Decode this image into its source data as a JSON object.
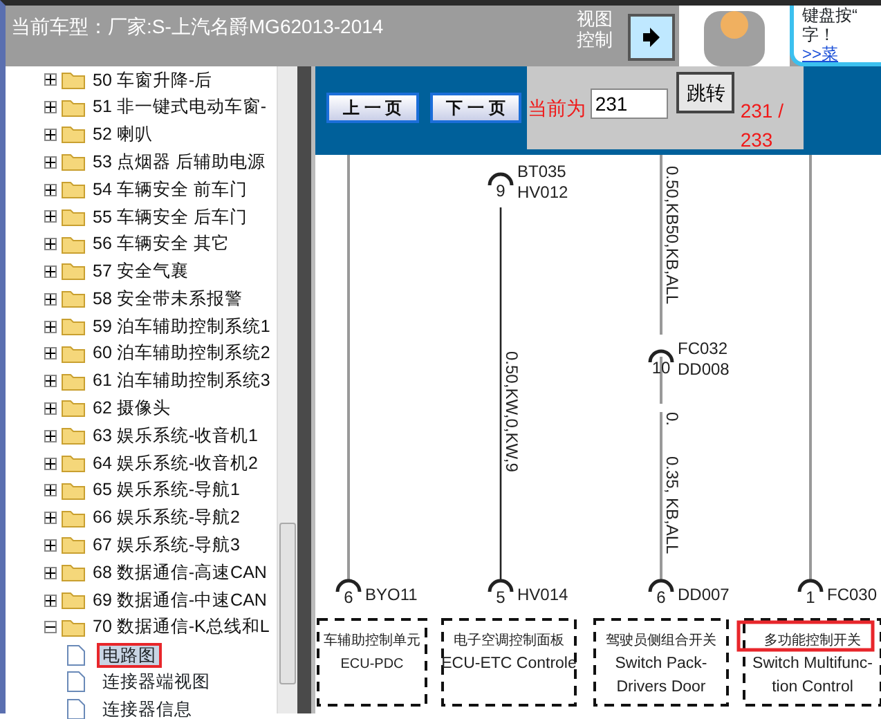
{
  "header": {
    "title": "当前车型：厂家:S-上汽名爵MG62013-2014",
    "view_label": [
      "视图",
      "控制"
    ]
  },
  "ad": {
    "lines": [
      "键盘按“",
      "字！",
      ">>菜"
    ]
  },
  "tree": {
    "items": [
      {
        "label": "50  车窗升降-后",
        "expanded": false
      },
      {
        "label": "51  非一键式电动车窗-",
        "expanded": false
      },
      {
        "label": "52  喇叭",
        "expanded": false
      },
      {
        "label": "53  点烟器 后辅助电源",
        "expanded": false
      },
      {
        "label": "54  车辆安全 前车门",
        "expanded": false
      },
      {
        "label": "55  车辆安全 后车门",
        "expanded": false
      },
      {
        "label": "56  车辆安全 其它",
        "expanded": false
      },
      {
        "label": "57  安全气襄",
        "expanded": false
      },
      {
        "label": "58  安全带未系报警",
        "expanded": false
      },
      {
        "label": "59  泊车辅助控制系统1",
        "expanded": false
      },
      {
        "label": "60  泊车辅助控制系统2",
        "expanded": false
      },
      {
        "label": "61  泊车辅助控制系统3",
        "expanded": false
      },
      {
        "label": "62  摄像头",
        "expanded": false
      },
      {
        "label": "63  娱乐系统-收音机1",
        "expanded": false
      },
      {
        "label": "64  娱乐系统-收音机2",
        "expanded": false
      },
      {
        "label": "65  娱乐系统-导航1",
        "expanded": false
      },
      {
        "label": "66  娱乐系统-导航2",
        "expanded": false
      },
      {
        "label": "67  娱乐系统-导航3",
        "expanded": false
      },
      {
        "label": "68  数据通信-高速CAN",
        "expanded": false
      },
      {
        "label": "69  数据通信-中速CAN",
        "expanded": false
      },
      {
        "label": "70  数据通信-K总线和L",
        "expanded": true,
        "children": [
          {
            "label": "电路图",
            "selected": true,
            "highlighted": true
          },
          {
            "label": "连接器端视图",
            "selected": false,
            "highlighted": false
          },
          {
            "label": "连接器信息",
            "selected": false,
            "highlighted": false
          }
        ]
      }
    ]
  },
  "pager": {
    "prev": "上 一 页",
    "next": "下 一 页",
    "current_label": "当前为",
    "page_value": "231",
    "jump": "跳转",
    "total": "231 / 233"
  },
  "diagram": {
    "top_connectors": [
      {
        "pin": "9",
        "codes": [
          "BT035",
          "HV012"
        ]
      },
      {
        "pin": "10",
        "codes": [
          "FC032",
          "DD008"
        ]
      }
    ],
    "wire_labels": [
      "0.50,KB50,KB,ALL",
      "0.50,KW,0,KW,9",
      "0.",
      "0.35, KB,ALL"
    ],
    "components": [
      {
        "pin": "6",
        "code": "BYO11",
        "lines": [
          "车辅助控制单元",
          "ECU-PDC"
        ],
        "highlighted": false
      },
      {
        "pin": "5",
        "code": "HV014",
        "lines": [
          "电子空调控制面板",
          "ECU-ETC Controle"
        ],
        "highlighted": false
      },
      {
        "pin": "6",
        "code": "DD007",
        "lines": [
          "驾驶员侧组合开关",
          "Switch Pack-",
          "Drivers Door"
        ],
        "highlighted": false
      },
      {
        "pin": "1",
        "code": "FC030",
        "lines": [
          "多功能控制开关",
          "Switch Multifunc-",
          "tion Control"
        ],
        "highlighted": true
      }
    ]
  }
}
